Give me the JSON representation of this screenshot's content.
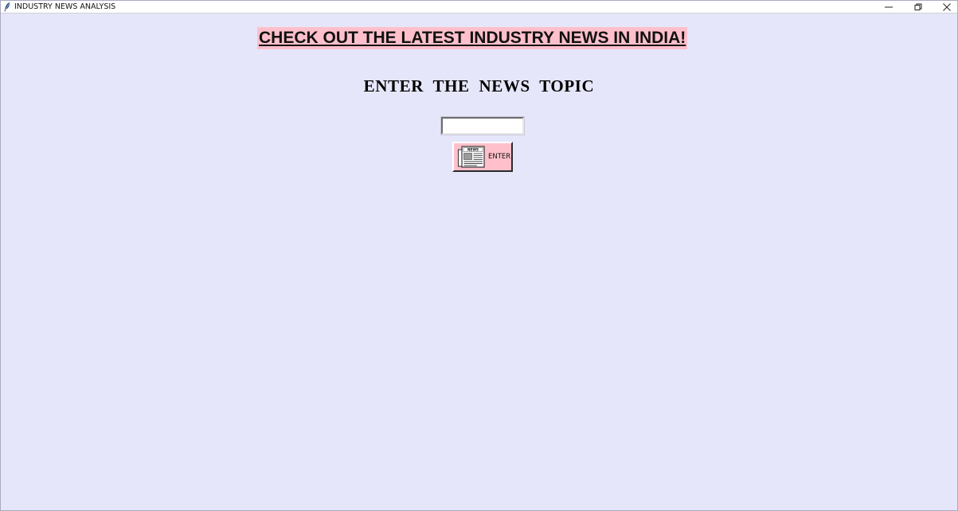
{
  "window": {
    "title": "INDUSTRY NEWS ANALYSIS",
    "background": "#E6E6FA",
    "app_icon": "feather-icon",
    "controls": {
      "minimize": "minimize-icon",
      "restore": "restore-icon",
      "close": "close-icon"
    }
  },
  "main": {
    "headline": "CHECK OUT THE LATEST INDUSTRY NEWS IN INDIA!",
    "headline_bg": "#FFC0CB",
    "prompt_label": "ENTER  THE  NEWS  TOPIC",
    "topic_input": {
      "value": "",
      "placeholder": ""
    },
    "enter_button": {
      "label": "ENTER",
      "icon": "newspaper-icon",
      "icon_text": "NEWS",
      "bg": "#FFC0CB"
    }
  }
}
